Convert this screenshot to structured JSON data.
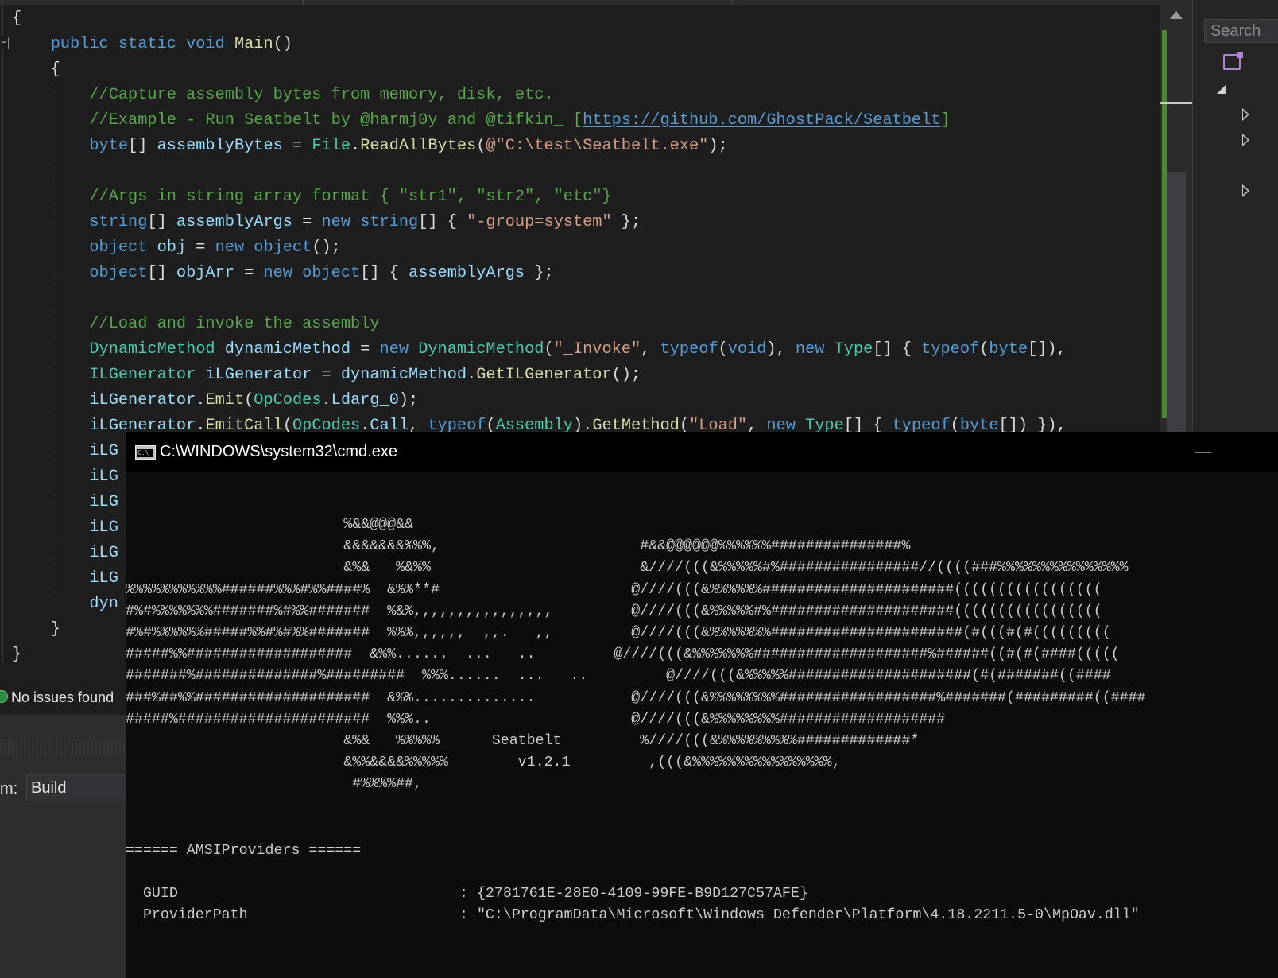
{
  "editor": {
    "code_lines": [
      [
        {
          "t": "{"
        }
      ],
      [
        {
          "t": "    "
        },
        {
          "t": "public",
          "c": "k"
        },
        {
          "t": " "
        },
        {
          "t": "static",
          "c": "k"
        },
        {
          "t": " "
        },
        {
          "t": "void",
          "c": "k"
        },
        {
          "t": " "
        },
        {
          "t": "Main",
          "c": "m"
        },
        {
          "t": "()"
        }
      ],
      [
        {
          "t": "    {"
        }
      ],
      [
        {
          "t": "        "
        },
        {
          "t": "//Capture assembly bytes from memory, disk, etc.",
          "c": "c"
        }
      ],
      [
        {
          "t": "        "
        },
        {
          "t": "//Example - Run Seatbelt by @harmj0y and @tifkin_ [",
          "c": "c"
        },
        {
          "t": "https://github.com/GhostPack/Seatbelt",
          "c": "u"
        },
        {
          "t": "]",
          "c": "c"
        }
      ],
      [
        {
          "t": "        "
        },
        {
          "t": "byte",
          "c": "k"
        },
        {
          "t": "[] "
        },
        {
          "t": "assemblyBytes",
          "c": "v"
        },
        {
          "t": " = "
        },
        {
          "t": "File",
          "c": "t"
        },
        {
          "t": "."
        },
        {
          "t": "ReadAllBytes",
          "c": "m"
        },
        {
          "t": "("
        },
        {
          "t": "@\"C:\\test\\Seatbelt.exe\"",
          "c": "s"
        },
        {
          "t": ");"
        }
      ],
      [
        {
          "t": ""
        }
      ],
      [
        {
          "t": "        "
        },
        {
          "t": "//Args in string array format { \"str1\", \"str2\", \"etc\"}",
          "c": "c"
        }
      ],
      [
        {
          "t": "        "
        },
        {
          "t": "string",
          "c": "k"
        },
        {
          "t": "[] "
        },
        {
          "t": "assemblyArgs",
          "c": "v"
        },
        {
          "t": " = "
        },
        {
          "t": "new",
          "c": "k"
        },
        {
          "t": " "
        },
        {
          "t": "string",
          "c": "k"
        },
        {
          "t": "[] { "
        },
        {
          "t": "\"-group=system\"",
          "c": "s"
        },
        {
          "t": " };"
        }
      ],
      [
        {
          "t": "        "
        },
        {
          "t": "object",
          "c": "k"
        },
        {
          "t": " "
        },
        {
          "t": "obj",
          "c": "v"
        },
        {
          "t": " = "
        },
        {
          "t": "new",
          "c": "k"
        },
        {
          "t": " "
        },
        {
          "t": "object",
          "c": "k"
        },
        {
          "t": "();"
        }
      ],
      [
        {
          "t": "        "
        },
        {
          "t": "object",
          "c": "k"
        },
        {
          "t": "[] "
        },
        {
          "t": "objArr",
          "c": "v"
        },
        {
          "t": " = "
        },
        {
          "t": "new",
          "c": "k"
        },
        {
          "t": " "
        },
        {
          "t": "object",
          "c": "k"
        },
        {
          "t": "[] { "
        },
        {
          "t": "assemblyArgs",
          "c": "v"
        },
        {
          "t": " };"
        }
      ],
      [
        {
          "t": ""
        }
      ],
      [
        {
          "t": "        "
        },
        {
          "t": "//Load and invoke the assembly",
          "c": "c"
        }
      ],
      [
        {
          "t": "        "
        },
        {
          "t": "DynamicMethod",
          "c": "t"
        },
        {
          "t": " "
        },
        {
          "t": "dynamicMethod",
          "c": "v"
        },
        {
          "t": " = "
        },
        {
          "t": "new",
          "c": "k"
        },
        {
          "t": " "
        },
        {
          "t": "DynamicMethod",
          "c": "t"
        },
        {
          "t": "("
        },
        {
          "t": "\"_Invoke\"",
          "c": "s"
        },
        {
          "t": ", "
        },
        {
          "t": "typeof",
          "c": "k"
        },
        {
          "t": "("
        },
        {
          "t": "void",
          "c": "k"
        },
        {
          "t": "), "
        },
        {
          "t": "new",
          "c": "k"
        },
        {
          "t": " "
        },
        {
          "t": "Type",
          "c": "t"
        },
        {
          "t": "[] { "
        },
        {
          "t": "typeof",
          "c": "k"
        },
        {
          "t": "("
        },
        {
          "t": "byte",
          "c": "k"
        },
        {
          "t": "[]),"
        }
      ],
      [
        {
          "t": "        "
        },
        {
          "t": "ILGenerator",
          "c": "t"
        },
        {
          "t": " "
        },
        {
          "t": "iLGenerator",
          "c": "v"
        },
        {
          "t": " = "
        },
        {
          "t": "dynamicMethod",
          "c": "v"
        },
        {
          "t": "."
        },
        {
          "t": "GetILGenerator",
          "c": "m"
        },
        {
          "t": "();"
        }
      ],
      [
        {
          "t": "        "
        },
        {
          "t": "iLGenerator",
          "c": "v"
        },
        {
          "t": "."
        },
        {
          "t": "Emit",
          "c": "m"
        },
        {
          "t": "("
        },
        {
          "t": "OpCodes",
          "c": "t"
        },
        {
          "t": "."
        },
        {
          "t": "Ldarg_0",
          "c": "v"
        },
        {
          "t": ");"
        }
      ],
      [
        {
          "t": "        "
        },
        {
          "t": "iLGenerator",
          "c": "v"
        },
        {
          "t": "."
        },
        {
          "t": "EmitCall",
          "c": "m"
        },
        {
          "t": "("
        },
        {
          "t": "OpCodes",
          "c": "t"
        },
        {
          "t": "."
        },
        {
          "t": "Call",
          "c": "v"
        },
        {
          "t": ", "
        },
        {
          "t": "typeof",
          "c": "k"
        },
        {
          "t": "("
        },
        {
          "t": "Assembly",
          "c": "t"
        },
        {
          "t": ")."
        },
        {
          "t": "GetMethod",
          "c": "m"
        },
        {
          "t": "("
        },
        {
          "t": "\"Load\"",
          "c": "s"
        },
        {
          "t": ", "
        },
        {
          "t": "new",
          "c": "k"
        },
        {
          "t": " "
        },
        {
          "t": "Type",
          "c": "t"
        },
        {
          "t": "[] { "
        },
        {
          "t": "typeof",
          "c": "k"
        },
        {
          "t": "("
        },
        {
          "t": "byte",
          "c": "k"
        },
        {
          "t": "[]) }),"
        }
      ],
      [
        {
          "t": "        "
        },
        {
          "t": "iLG",
          "c": "v"
        }
      ],
      [
        {
          "t": "        "
        },
        {
          "t": "iLG",
          "c": "v"
        }
      ],
      [
        {
          "t": "        "
        },
        {
          "t": "iLG",
          "c": "v"
        }
      ],
      [
        {
          "t": "        "
        },
        {
          "t": "iLG",
          "c": "v"
        }
      ],
      [
        {
          "t": "        "
        },
        {
          "t": "iLG",
          "c": "v"
        }
      ],
      [
        {
          "t": "        "
        },
        {
          "t": "iLG",
          "c": "v"
        }
      ],
      [
        {
          "t": "        "
        },
        {
          "t": "dyn",
          "c": "v"
        }
      ],
      [
        {
          "t": "    }"
        }
      ],
      [
        {
          "t": "}"
        }
      ]
    ]
  },
  "solution_explorer": {
    "search_placeholder": "Search"
  },
  "error_list": {
    "status_text": "No issues found",
    "show_output_label": "m:",
    "show_output_value": "Build"
  },
  "cmd": {
    "title": "C:\\WINDOWS\\system32\\cmd.exe",
    "minimize_glyph": "—",
    "banner_lines": [
      "                         %&&@@@&&",
      "                         &&&&&&&%%%,                       #&&@@@@@@%%%%%%###############%",
      "                         &%&   %&%%                        &////(((&%%%%%#%################//((((###%%%%%%%%%%%%%%%",
      "%%%%%%%%%%%######%%%#%%####%  &%%**#                      @////(((&%%%%%%######################(((((((((((((((((",
      "#%#%%%%%%%#######%#%%#######  %&%,,,,,,,,,,,,,,,,         @////(((&%%%%%#%#####################(((((((((((((((((",
      "#%#%%%%%%#####%%#%#%%#######  %%%,,,,,,  ,,.   ,,         @////(((&%%%%%%%######################(#(((#(#(((((((((",
      "#####%%###################  &%%......  ...   ..         @////(((&%%%%%%%####################%######((#(#(####(((((",
      "#######%##############%#########  %%%......  ...   ..         @////(((&%%%%%#####################(#(#######((####",
      "###%##%%####################  &%%..............           @////(((&%%%%%%%%##################%#######(#########((####",
      "#####%######################  %%%..                       @////(((&%%%%%%%%###################",
      "                         &%&   %%%%%      Seatbelt         %////(((&%%%%%%%%%#############*",
      "                         &%%&&&&%%%%%        v1.2.1         ,(((&%%%%%%%%%%%%%%%%,",
      "                          #%%%%##,"
    ],
    "amsi_header": "====== AMSIProviders ======",
    "amsi_rows": [
      {
        "key": "  GUID",
        "value": ": {2781761E-28E0-4109-99FE-B9D127C57AFE}"
      },
      {
        "key": "  ProviderPath",
        "value": ": \"C:\\ProgramData\\Microsoft\\Windows Defender\\Platform\\4.18.2211.5-0\\MpOav.dll\""
      }
    ]
  }
}
